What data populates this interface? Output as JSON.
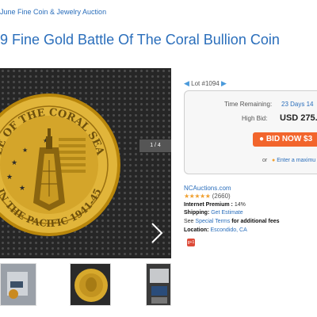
{
  "header": {
    "breadcrumb": "June Fine Coin & Jewelry Auction",
    "title": "9 Fine Gold Battle Of The Coral Bullion Coin"
  },
  "gallery": {
    "counter": "1 / 4",
    "coin_text_top": "LE OF THE CORAL SEA",
    "coin_text_bottom": "IN THE PACIFIC 1941-45",
    "colors": {
      "coin_gold": "#d9a925",
      "coin_rim": "#b8860b",
      "background": "#262626"
    }
  },
  "lot": {
    "prev_arrow": "◀",
    "label": "Lot #1094",
    "next_arrow": "▶"
  },
  "bid_box": {
    "time_remaining_label": "Time Remaining:",
    "time_remaining_value": "23 Days 14",
    "high_bid_label": "High Bid:",
    "high_bid_value": "USD 275.",
    "bid_button": "BID NOW $3",
    "or_text": "or",
    "max_link": "Enter a maximu"
  },
  "seller": {
    "name": "NCAuctions.com",
    "stars": "★★★★★",
    "rating_count": "(2660)",
    "premium_label": "Internet Premium :",
    "premium_value": "14%",
    "shipping_label": "Shipping:",
    "shipping_link": "Get Estimate",
    "see_text": "See",
    "terms_link": "Special Terms",
    "terms_suffix": "for additional fees",
    "location_label": "Location:",
    "location_value": "Escondido, CA",
    "gplus": "g+1"
  },
  "colors": {
    "link": "#2a6ebb",
    "bid_button": "#f2652c",
    "star": "#f0a030"
  }
}
